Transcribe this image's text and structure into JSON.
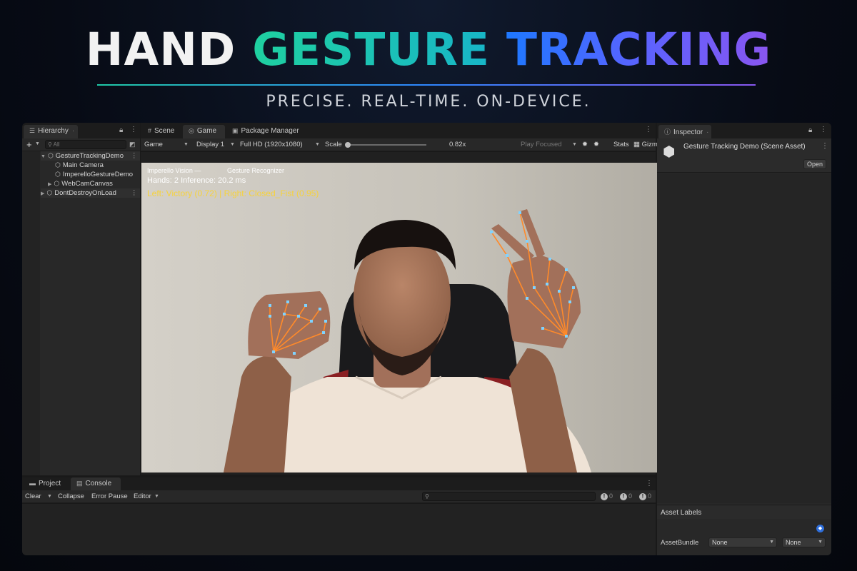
{
  "banner": {
    "title_part1": "HAND",
    "title_part2": "GESTURE",
    "title_part3": "TRACKING",
    "subtitle": "PRECISE. REAL-TIME. ON-DEVICE."
  },
  "hierarchy": {
    "tab_label": "Hierarchy",
    "search_placeholder": "All",
    "items": [
      {
        "label": "GestureTrackingDemo",
        "expanded": true
      },
      {
        "label": "Main Camera"
      },
      {
        "label": "ImperelloGestureDemo"
      },
      {
        "label": "WebCamCanvas",
        "collapsed": true
      },
      {
        "label": "DontDestroyOnLoad",
        "collapsed": true
      }
    ]
  },
  "center_tabs": {
    "scene": "Scene",
    "game": "Game",
    "package_manager": "Package Manager"
  },
  "game_toolbar": {
    "view_mode": "Game",
    "display": "Display 1",
    "resolution": "Full HD (1920x1080)",
    "scale_label": "Scale",
    "scale_value": "0.82x",
    "play_mode": "Play Focused",
    "stats": "Stats",
    "gizmos": "Gizmos"
  },
  "hud": {
    "brand": "Imperello Vision —",
    "recognizer": "Gesture Recognizer",
    "stats_line": "Hands: 2   Inference: 20.2 ms",
    "gesture_line": "Left: Victory (0.72)   |   Right: Closed_Fist (0.95)"
  },
  "console_tabs": {
    "project": "Project",
    "console": "Console"
  },
  "console_toolbar": {
    "clear": "Clear",
    "collapse": "Collapse",
    "error_pause": "Error Pause",
    "editor": "Editor",
    "info_count": "0",
    "warning_count": "0",
    "error_count": "0"
  },
  "inspector": {
    "tab_label": "Inspector",
    "title": "Gesture Tracking Demo (Scene Asset)",
    "open_button": "Open",
    "asset_labels": "Asset Labels",
    "asset_bundle_label": "AssetBundle",
    "bundle_value": "None",
    "variant_value": "None"
  },
  "colors": {
    "gesture_text": "#f7d23a",
    "landmark_line": "#ff8a2a",
    "landmark_point": "#7fd3ff",
    "editor_bg": "#191919"
  }
}
